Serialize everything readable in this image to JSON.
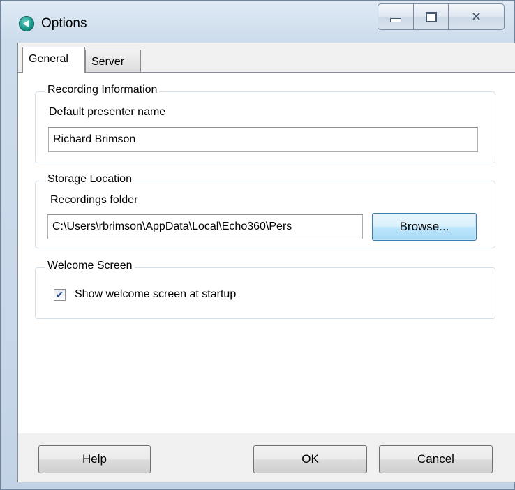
{
  "window": {
    "title": "Options",
    "minimize_glyph": "",
    "maximize_glyph": "",
    "close_glyph": "✕"
  },
  "tabs": [
    {
      "label": "General",
      "active": true
    },
    {
      "label": "Server",
      "active": false
    }
  ],
  "recording_info": {
    "legend": "Recording Information",
    "presenter_label": "Default presenter name",
    "presenter_value": "Richard Brimson"
  },
  "storage": {
    "legend": "Storage Location",
    "folder_label": "Recordings folder",
    "folder_value": "C:\\Users\\rbrimson\\AppData\\Local\\Echo360\\Pers",
    "browse_label": "Browse..."
  },
  "welcome": {
    "legend": "Welcome Screen",
    "checkbox_label": "Show welcome screen at startup",
    "checked": true,
    "check_glyph": "✔"
  },
  "footer": {
    "help_label": "Help",
    "ok_label": "OK",
    "cancel_label": "Cancel"
  },
  "colors": {
    "accent_focus": "#3c7fb1",
    "app_icon": "#1a9a8c"
  }
}
